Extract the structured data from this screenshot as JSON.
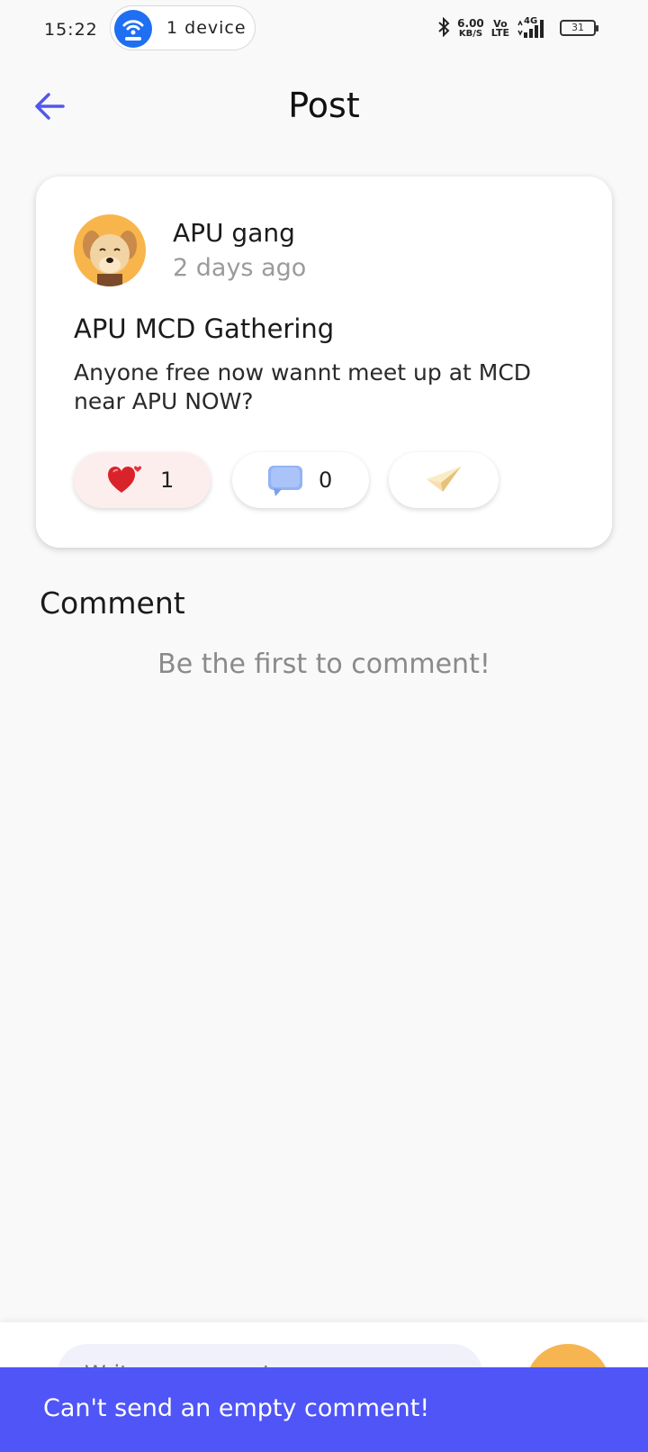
{
  "status_bar": {
    "time": "15:22",
    "hotspot_label": "1 device",
    "speed_value": "6.00",
    "speed_unit": "KB/S",
    "volte_top": "Vo",
    "volte_bottom": "LTE",
    "network": "4G",
    "battery": "31"
  },
  "header": {
    "title": "Post"
  },
  "post": {
    "author": "APU gang",
    "time_ago": "2 days ago",
    "title": "APU MCD Gathering",
    "body": "Anyone free now wannt meet up at MCD near APU NOW?",
    "like_count": "1",
    "comment_count": "0"
  },
  "comments": {
    "heading": "Comment",
    "empty_message": "Be the first to comment!"
  },
  "input": {
    "placeholder": "Write a comment"
  },
  "snackbar": {
    "message": "Can't send an empty comment!"
  },
  "colors": {
    "accent": "#4f55f7",
    "send_button": "#f6b551",
    "like_pill": "#fdeeee"
  }
}
